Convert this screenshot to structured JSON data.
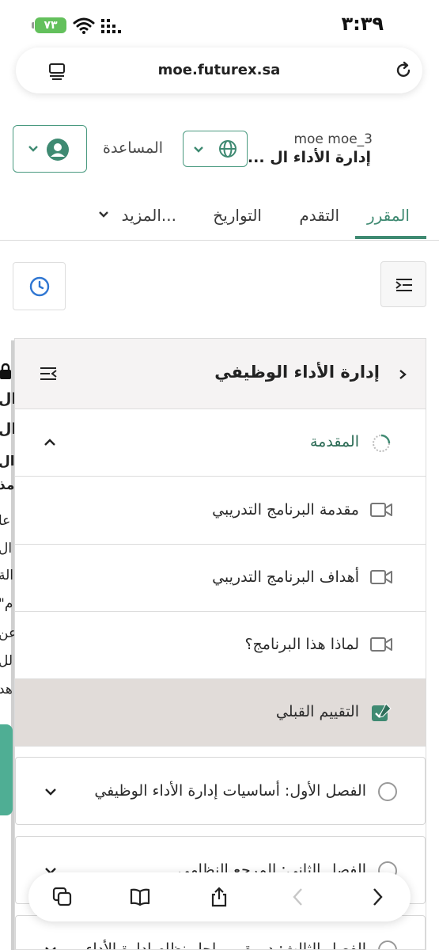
{
  "status": {
    "time": "٣:٣٩",
    "battery": "٧٣"
  },
  "browser": {
    "url": "moe.futurex.sa"
  },
  "header": {
    "help_label": "المساعدة",
    "org_subtitle": "moe moe_3",
    "org_title": "إدارة الأداء ال ..."
  },
  "tabs": [
    {
      "label": "المقرر",
      "active": true
    },
    {
      "label": "التقدم",
      "active": false
    },
    {
      "label": "التواريخ",
      "active": false
    },
    {
      "label": "المزيد...",
      "active": false
    }
  ],
  "outline": {
    "title": "إدارة الأداء الوظيفي",
    "items": [
      {
        "label": "المقدمة",
        "type": "section",
        "icon": "partial-progress-icon",
        "expanded": true
      },
      {
        "label": "مقدمة البرنامج التدريبي",
        "type": "video",
        "icon": "video-icon"
      },
      {
        "label": "أهداف البرنامج التدريبي",
        "type": "video",
        "icon": "video-icon"
      },
      {
        "label": "لماذا هذا البرنامج؟",
        "type": "video",
        "icon": "video-icon"
      },
      {
        "label": "التقييم القبلي",
        "type": "assessment",
        "icon": "edit-check-icon",
        "selected": true
      },
      {
        "label": "الفصل الأول: أساسيات إدارة الأداء الوظيفي",
        "type": "chapter",
        "icon": "circle-icon"
      },
      {
        "label": "الفصل الثاني: المرجع النظامي",
        "type": "chapter",
        "icon": "circle-icon"
      },
      {
        "label": "الفصل الثالث: دورة ومراحل نظام إدارة الأداء",
        "type": "chapter",
        "icon": "circle-icon"
      }
    ]
  },
  "background_text": [
    "ال",
    "ال",
    "ال",
    "مذ",
    "عا",
    "ال",
    "الة",
    "\"م",
    "عن",
    "لل",
    "هد"
  ],
  "colors": {
    "accent": "#3f8a72",
    "selected_row": "#e1dcd9",
    "battery": "#63c05c"
  }
}
